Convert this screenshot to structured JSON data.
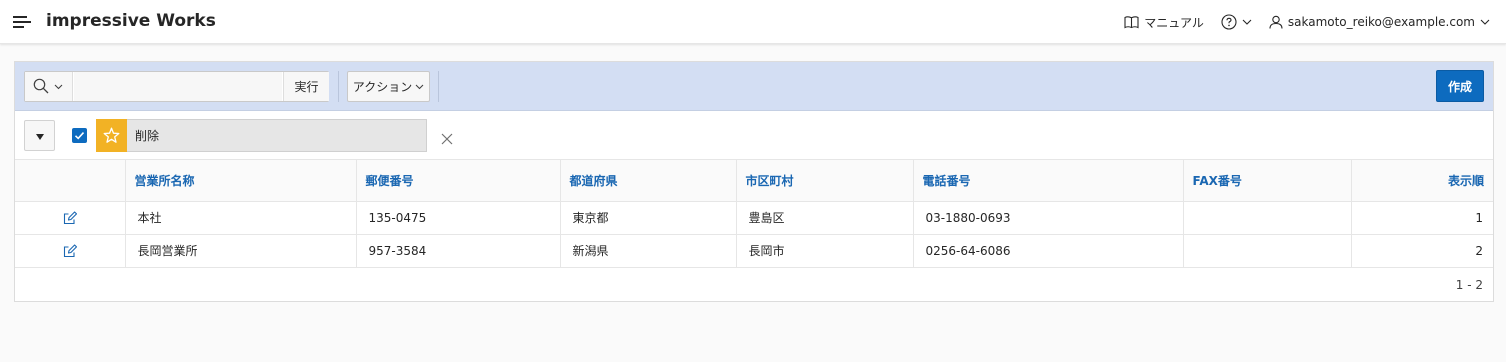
{
  "app": {
    "title": "impressive Works"
  },
  "nav": {
    "manual_label": "マニュアル",
    "user_email": "sakamoto_reiko@example.com"
  },
  "toolbar": {
    "search_placeholder": "",
    "go_label": "実行",
    "actions_label": "アクション",
    "create_label": "作成"
  },
  "filter": {
    "saved_report_label": "削除",
    "checked": true
  },
  "table": {
    "columns": [
      "営業所名称",
      "郵便番号",
      "都道府県",
      "市区町村",
      "電話番号",
      "FAX番号",
      "表示順"
    ],
    "rows": [
      {
        "name": "本社",
        "postal": "135-0475",
        "prefecture": "東京都",
        "city": "豊島区",
        "phone": "03-1880-0693",
        "fax": "",
        "order": "1"
      },
      {
        "name": "長岡営業所",
        "postal": "957-3584",
        "prefecture": "新潟県",
        "city": "長岡市",
        "phone": "0256-64-6086",
        "fax": "",
        "order": "2"
      }
    ]
  },
  "pagination": {
    "text": "1 - 2"
  },
  "colors": {
    "accent": "#0d6bbf",
    "toolbar_bg": "#d3def3",
    "star": "#f2b225",
    "header_link": "#1a67b2"
  }
}
